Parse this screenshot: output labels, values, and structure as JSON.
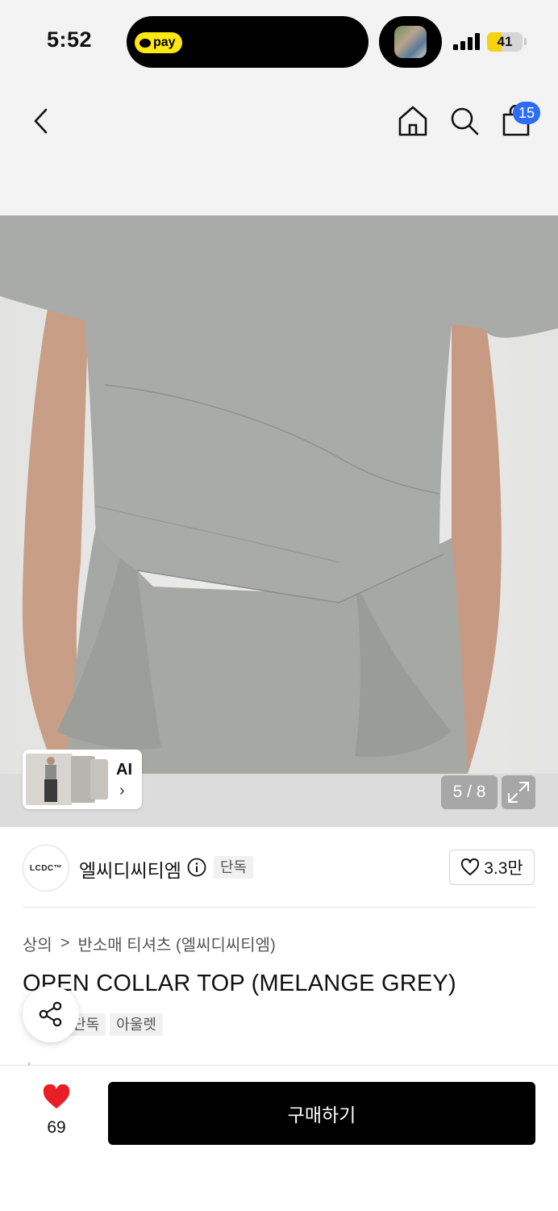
{
  "status_bar": {
    "time": "5:52",
    "pay_label": "pay",
    "battery_level": "41",
    "battery_fraction": 0.41
  },
  "header": {
    "back_icon": "chevron-left-icon",
    "home_icon": "home-icon",
    "search_icon": "search-icon",
    "cart_icon": "shopping-bag-icon",
    "cart_count": "15"
  },
  "gallery": {
    "ai_label": "AI",
    "ai_chevron": "›",
    "counter": "5 / 8",
    "expand_icon": "expand-icon"
  },
  "brand": {
    "logo_text": "LCDC™",
    "name": "엘씨디씨티엠",
    "info_icon": "info-icon",
    "exclusive_badge": "단독",
    "like_count": "3.3만"
  },
  "product": {
    "breadcrumb": [
      "상의",
      "반소매 티셔츠 (엘씨디씨티엠)"
    ],
    "breadcrumb_separator": ">",
    "title": "OPEN COLLAR TOP (MELANGE GREY)",
    "tags": [
      "단독",
      "아울렛"
    ],
    "share_icon": "share-icon"
  },
  "bottom_bar": {
    "wish_icon": "heart-filled-icon",
    "wish_count": "69",
    "buy_label": "구매하기"
  },
  "colors": {
    "cart_badge": "#2f6cf6",
    "wish_heart": "#ea1e25",
    "buy_button": "#000000",
    "pay_yellow": "#ffe812"
  }
}
